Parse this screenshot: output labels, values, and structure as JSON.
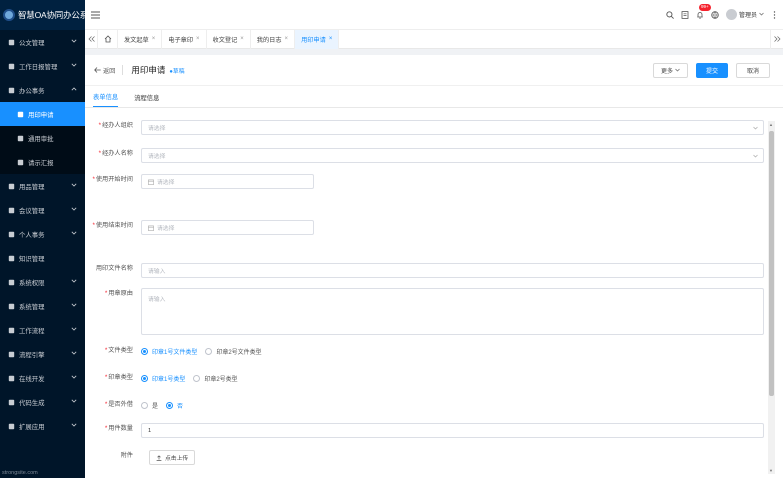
{
  "brand": {
    "title": "智慧OA协同办公系统"
  },
  "sidebar": {
    "items": [
      {
        "label": "公文管理",
        "icon": "document-icon",
        "has_arrow": true
      },
      {
        "label": "工作日报管理",
        "icon": "report-icon",
        "has_arrow": true
      },
      {
        "label": "办公事务",
        "icon": "office-icon",
        "has_arrow": true,
        "expanded": true
      },
      {
        "label": "用印申请",
        "icon": "seal-icon",
        "sub": true,
        "active": true
      },
      {
        "label": "通用审批",
        "icon": "approval-icon",
        "sub": true
      },
      {
        "label": "请示汇报",
        "icon": "request-icon",
        "sub": true
      },
      {
        "label": "用品管理",
        "icon": "supplies-icon",
        "has_arrow": true
      },
      {
        "label": "会议管理",
        "icon": "meeting-icon",
        "has_arrow": true
      },
      {
        "label": "个人事务",
        "icon": "user-icon",
        "has_arrow": true
      },
      {
        "label": "知识管理",
        "icon": "book-icon"
      },
      {
        "label": "系统权限",
        "icon": "shield-icon",
        "has_arrow": true
      },
      {
        "label": "系统管理",
        "icon": "gear-icon",
        "has_arrow": true
      },
      {
        "label": "工作流程",
        "icon": "workflow-icon",
        "has_arrow": true
      },
      {
        "label": "流程引擎",
        "icon": "engine-icon",
        "has_arrow": true
      },
      {
        "label": "在线开发",
        "icon": "dev-icon",
        "has_arrow": true
      },
      {
        "label": "代码生成",
        "icon": "code-icon",
        "has_arrow": true
      },
      {
        "label": "扩展应用",
        "icon": "apps-icon",
        "has_arrow": true
      }
    ],
    "footer": "strongsite.com"
  },
  "header": {
    "badge": "99+",
    "user_name": "管理员"
  },
  "tabs": [
    {
      "label": "发文起草"
    },
    {
      "label": "电子章印"
    },
    {
      "label": "收文登记"
    },
    {
      "label": "我的日志"
    },
    {
      "label": "用印申请",
      "active": true
    }
  ],
  "page": {
    "back_label": "返回",
    "title": "用印申请",
    "status": "●草稿",
    "more_label": "更多",
    "submit_label": "提交",
    "cancel_label": "取消"
  },
  "form_tabs": [
    {
      "label": "表单信息",
      "active": true
    },
    {
      "label": "流程信息"
    }
  ],
  "form": {
    "org": {
      "label": "经办人组织",
      "required": true,
      "placeholder": "请选择"
    },
    "name": {
      "label": "经办人名称",
      "required": true,
      "placeholder": "请选择"
    },
    "start": {
      "label": "使用开始时间",
      "required": true,
      "placeholder": "请选择"
    },
    "end": {
      "label": "使用结束时间",
      "required": true,
      "placeholder": "请选择"
    },
    "file": {
      "label": "用印文件名称",
      "required": false,
      "placeholder": "请输入"
    },
    "reason": {
      "label": "用章原由",
      "required": true,
      "placeholder": "请输入"
    },
    "file_type": {
      "label": "文件类型",
      "required": true,
      "options": [
        "印章1号文件类型",
        "印章2号文件类型"
      ],
      "selected": 0
    },
    "seal_type": {
      "label": "印章类型",
      "required": true,
      "options": [
        "印章1号类型",
        "印章2号类型"
      ],
      "selected": 0
    },
    "external": {
      "label": "是否外借",
      "required": true,
      "options": [
        "是",
        "否"
      ],
      "selected": 1
    },
    "count": {
      "label": "用件数量",
      "required": true,
      "value": "1"
    },
    "attachment": {
      "label": "附件",
      "required": false,
      "upload_label": "点击上传"
    }
  },
  "colors": {
    "primary": "#1890ff",
    "sidebar_bg": "#001529",
    "required": "#f5222d"
  }
}
